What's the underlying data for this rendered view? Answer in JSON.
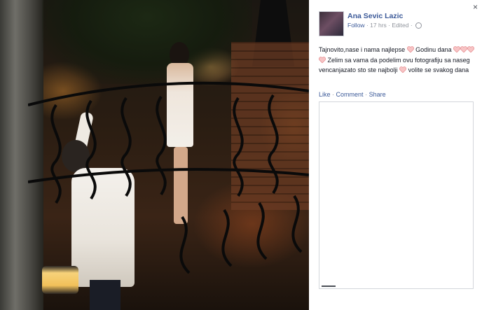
{
  "post": {
    "author": "Ana Sevic Lazic",
    "follow": "Follow",
    "sep1": "·",
    "time": "17 hrs",
    "sep2": "·",
    "edited": "Edited",
    "sep3": "·",
    "text_part1": "Tajnovito,nase i nama najlepse ",
    "text_part2": " Godinu dana ",
    "text_part3": "Zelim sa vama da podelim ovu fotografiju sa naseg vencanjazato sto ste najbolji ",
    "text_part4": " volite se svakog dana"
  },
  "actions": {
    "like": "Like",
    "comment": "Comment",
    "share": "Share",
    "dot": "·"
  },
  "close_glyph": "×",
  "icons": {
    "heart_color": "#f4a6a8",
    "link_color": "#3b5998"
  }
}
